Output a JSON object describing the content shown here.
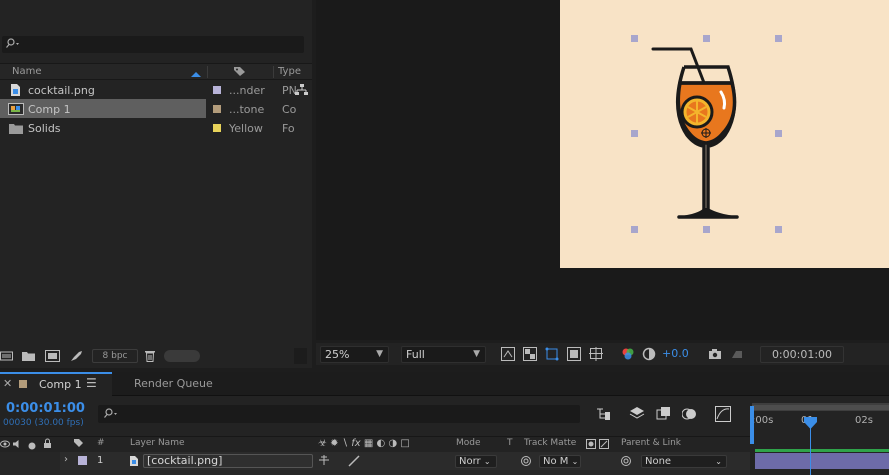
{
  "project": {
    "columns": {
      "name": "Name",
      "type": "Type"
    },
    "items": [
      {
        "name": "cocktail.png",
        "label_color": "#b8b3d8",
        "type": "...nder",
        "kind": "PN"
      },
      {
        "name": "Comp 1",
        "label_color": "#b39c7b",
        "type": "...tone",
        "kind": "Co",
        "selected": true
      },
      {
        "name": "Solids",
        "label_color": "#e8d35a",
        "type": "Yellow",
        "kind": "Fo"
      }
    ],
    "bpc": "8 bpc"
  },
  "viewer": {
    "zoom": "25%",
    "resolution": "Full",
    "exposure": "+0.0",
    "timecode": "0:00:01:00",
    "canvas_color": "#f8e3c6"
  },
  "timeline": {
    "tabs": [
      {
        "label": "Comp 1"
      },
      {
        "label": "Render Queue"
      }
    ],
    "current_time": "0:00:01:00",
    "current_frame": "00030 (30.00 fps)",
    "header": {
      "number": "#",
      "layer_name": "Layer Name",
      "mode": "Mode",
      "t": "T",
      "track_matte": "Track Matte",
      "parent": "Parent & Link"
    },
    "layer": {
      "index": "1",
      "name": "[cocktail.png]",
      "mode": "Norr",
      "track_matte": "No M",
      "parent": "None"
    },
    "ruler": [
      "0:00s",
      "01s",
      "02s"
    ],
    "ruler_shown": [
      ":00s",
      "01",
      "02s"
    ]
  },
  "colors": {
    "accent": "#3b8ee8",
    "layer_bar": "#6d6ba8"
  }
}
